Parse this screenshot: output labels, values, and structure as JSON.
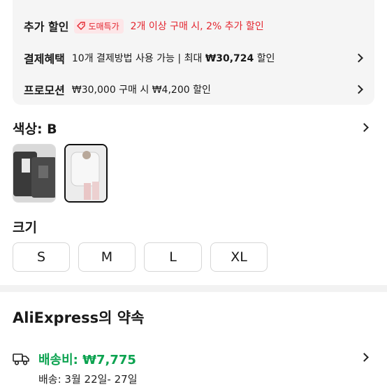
{
  "promo": {
    "extra_discount": {
      "title": "추가 할인",
      "badge": "도매특가",
      "text": "2개 이상 구매 시, 2% 추가 할인"
    },
    "payment_benefit": {
      "title": "결제혜택",
      "text_prefix": "10개 결제방법 사용 가능 | 최대 ",
      "amount": "₩30,724",
      "text_suffix": " 할인"
    },
    "promotion": {
      "title": "프로모션",
      "text": "₩30,000 구매 시 ₩4,200 할인"
    }
  },
  "color": {
    "label": "색상: B",
    "options": [
      "A",
      "B"
    ],
    "selected": "B"
  },
  "size": {
    "label": "크기",
    "options": [
      "S",
      "M",
      "L",
      "XL"
    ]
  },
  "promise": {
    "title": "AliExpress의 약속",
    "shipping_fee": "배송비: ₩7,775",
    "shipping_date": "배송: 3월 22일- 27일"
  },
  "colors": {
    "accent_red": "#e4262f",
    "shipping_green": "#0ca350"
  }
}
